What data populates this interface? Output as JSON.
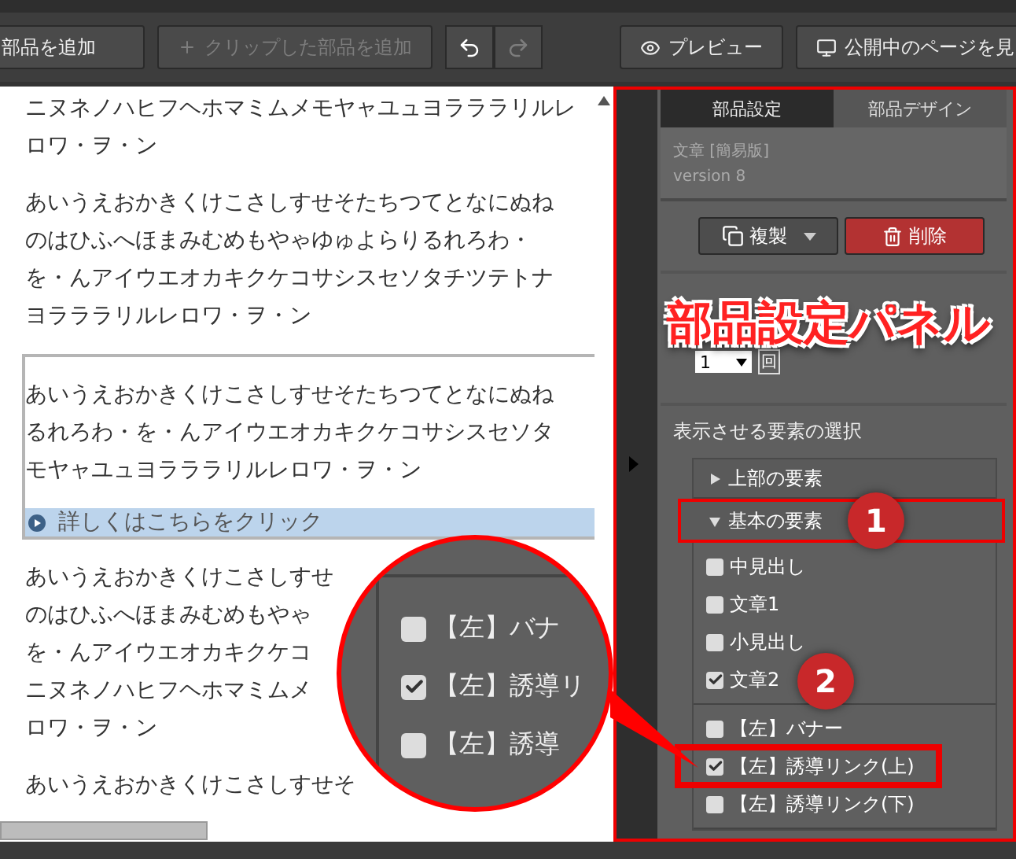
{
  "toolbar": {
    "left_buttons": [
      {
        "label": "部品を追加",
        "disabled": false
      },
      {
        "label": "クリップした部品を追加",
        "disabled": true
      }
    ],
    "history_buttons": [
      {
        "kind": "undo",
        "disabled": false
      },
      {
        "kind": "redo",
        "disabled": true
      }
    ],
    "right_buttons": [
      {
        "label": "プレビュー"
      },
      {
        "label": "公開中のページを見"
      }
    ]
  },
  "content": {
    "blocks": [
      {
        "kind": "paragraph",
        "lines": [
          "ニヌネノハヒフヘホマミムメモヤャユュヨラララリルレ",
          "ロワ・ヲ・ン"
        ]
      },
      {
        "kind": "paragraph",
        "lines": [
          "あいうえおかきくけこさしすせそたちつてとなにぬね",
          "のはひふへほまみむめもやゃゆゅよらりるれろわ・",
          "を・んアイウエオカキクケコサシスセソタチツテトナ",
          "ヨラララリルレロワ・ヲ・ン"
        ]
      },
      {
        "kind": "box",
        "lines": [
          "あいうえおかきくけこさしすせそたちつてとなにぬね",
          "るれろわ・を・んアイウエオカキクケコサシスセソタ",
          "モヤャユュヨラララリルレロワ・ヲ・ン"
        ],
        "link": "詳しくはこちらをクリック"
      },
      {
        "kind": "paragraph",
        "lines": [
          "あいうえおかきくけこさしすせ",
          "のはひふへほまみむめもやゃ",
          "を・んアイウエオカキクケコ",
          "ニヌネノハヒフヘホマミムメ",
          "ロワ・ヲ・ン"
        ]
      },
      {
        "kind": "paragraph",
        "lines": [
          "あいうえおかきくけこさしすせそ"
        ]
      }
    ]
  },
  "panel": {
    "tabs": [
      {
        "label": "部品設定",
        "selected": true
      },
      {
        "label": "部品デザイン",
        "selected": false
      }
    ],
    "info": {
      "title": "文章 [簡易版]",
      "version": "version 8"
    },
    "actions": [
      {
        "kind": "copy",
        "label": "複製"
      },
      {
        "kind": "delete",
        "label": "削除"
      }
    ],
    "repeat": {
      "value": "1",
      "unit": "回"
    },
    "elements": {
      "heading": "表示させる要素の選択",
      "groups": [
        {
          "label": "上部の要素",
          "expanded": false
        },
        {
          "label": "基本の要素",
          "expanded": true,
          "sections": [
            [
              {
                "label": "中見出し",
                "checked": false
              },
              {
                "label": "文章1",
                "checked": false
              },
              {
                "label": "小見出し",
                "checked": false
              },
              {
                "label": "文章2",
                "checked": true
              }
            ],
            [
              {
                "label": "【左】バナー",
                "checked": false
              },
              {
                "label": "【左】誘導リンク(上)",
                "checked": true
              },
              {
                "label": "【左】誘導リンク(下)",
                "checked": false
              }
            ]
          ]
        }
      ]
    }
  },
  "annotations": {
    "panel_label": "部品設定パネル",
    "markers": [
      "1",
      "2"
    ],
    "magnifier": {
      "items": [
        {
          "label": "【左】バナ",
          "checked": false
        },
        {
          "label": "【左】誘導リ",
          "checked": true
        },
        {
          "label": "【左】誘導",
          "checked": false
        }
      ]
    }
  }
}
